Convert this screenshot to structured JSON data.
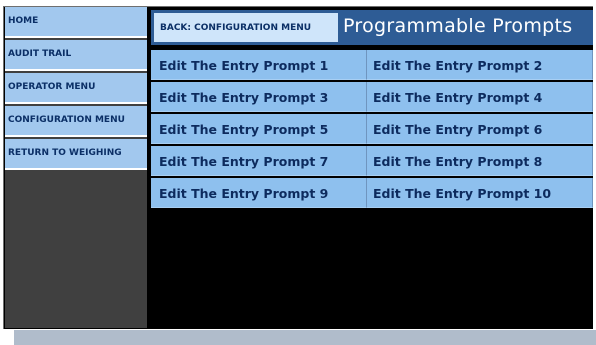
{
  "sidebar": {
    "items": [
      {
        "label": "HOME"
      },
      {
        "label": "AUDIT TRAIL"
      },
      {
        "label": "OPERATOR MENU"
      },
      {
        "label": "CONFIGURATION MENU"
      },
      {
        "label": "RETURN TO WEIGHING"
      }
    ]
  },
  "header": {
    "back_label": "BACK: CONFIGURATION MENU",
    "title": "Programmable Prompts"
  },
  "prompts": [
    {
      "label": "Edit The Entry Prompt 1"
    },
    {
      "label": "Edit The Entry Prompt 2"
    },
    {
      "label": "Edit The Entry Prompt 3"
    },
    {
      "label": "Edit The Entry Prompt 4"
    },
    {
      "label": "Edit The Entry Prompt 5"
    },
    {
      "label": "Edit The Entry Prompt 6"
    },
    {
      "label": "Edit The Entry Prompt 7"
    },
    {
      "label": "Edit The Entry Prompt 8"
    },
    {
      "label": "Edit The Entry Prompt 9"
    },
    {
      "label": "Edit The Entry Prompt 10"
    }
  ],
  "colors": {
    "nav_button": "#a2c8ee",
    "header_bar": "#2e5c95",
    "back_button": "#cfe5fa",
    "prompt_button": "#8ec0ee",
    "sidebar_bg": "#404040",
    "content_bg": "#000000"
  }
}
